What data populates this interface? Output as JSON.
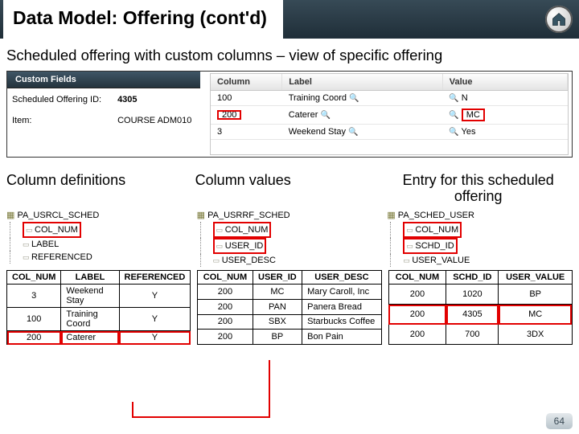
{
  "title": "Data Model: Offering (cont'd)",
  "subtitle": "Scheduled offering with custom columns – view of specific offering",
  "page_number": "64",
  "custom_fields": {
    "panel_title": "Custom Fields",
    "id_label": "Scheduled Offering ID:",
    "id_value": "4305",
    "item_label": "Item:",
    "item_value": "COURSE ADM010",
    "headers": {
      "col": "Column",
      "label": "Label",
      "value": "Value"
    },
    "rows": [
      {
        "col": "100",
        "label": "Training Coord",
        "value": "N",
        "highlight": false
      },
      {
        "col": "200",
        "label": "Caterer",
        "value": "MC",
        "highlight": true
      },
      {
        "col": "3",
        "label": "Weekend Stay",
        "value": "Yes",
        "highlight": false
      }
    ]
  },
  "sections": {
    "defs": "Column definitions",
    "values": "Column values",
    "entry": "Entry for this scheduled offering"
  },
  "trees": {
    "defs": {
      "root": "PA_USRCL_SCHED",
      "leaves": [
        "COL_NUM",
        "LABEL",
        "REFERENCED"
      ]
    },
    "values": {
      "root": "PA_USRRF_SCHED",
      "leaves": [
        "COL_NUM",
        "USER_ID",
        "USER_DESC"
      ]
    },
    "entry": {
      "root": "PA_SCHED_USER",
      "leaves": [
        "COL_NUM",
        "SCHD_ID",
        "USER_VALUE"
      ]
    }
  },
  "table_defs": {
    "headers": [
      "COL_NUM",
      "LABEL",
      "REFERENCED"
    ],
    "rows": [
      {
        "c": [
          "3",
          "Weekend Stay",
          "Y"
        ],
        "hi": false
      },
      {
        "c": [
          "100",
          "Training Coord",
          "Y"
        ],
        "hi": false
      },
      {
        "c": [
          "200",
          "Caterer",
          "Y"
        ],
        "hi": true
      }
    ]
  },
  "table_values": {
    "headers": [
      "COL_NUM",
      "USER_ID",
      "USER_DESC"
    ],
    "rows": [
      {
        "c": [
          "200",
          "MC",
          "Mary Caroll, Inc"
        ],
        "hi": false
      },
      {
        "c": [
          "200",
          "PAN",
          "Panera Bread"
        ],
        "hi": false
      },
      {
        "c": [
          "200",
          "SBX",
          "Starbucks Coffee"
        ],
        "hi": false
      },
      {
        "c": [
          "200",
          "BP",
          "Bon Pain"
        ],
        "hi": false
      }
    ]
  },
  "table_entry": {
    "headers": [
      "COL_NUM",
      "SCHD_ID",
      "USER_VALUE"
    ],
    "rows": [
      {
        "c": [
          "200",
          "1020",
          "BP"
        ],
        "hi": false
      },
      {
        "c": [
          "200",
          "4305",
          "MC"
        ],
        "hi": true
      },
      {
        "c": [
          "200",
          "700",
          "3DX"
        ],
        "hi": false
      }
    ]
  }
}
